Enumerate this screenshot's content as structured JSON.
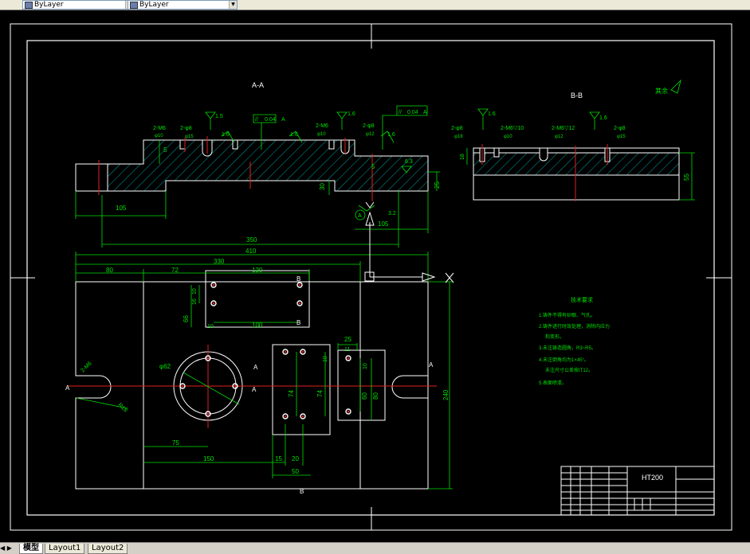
{
  "toolbar": {
    "layer_value": "ByLayer",
    "linetype_value": "ByLayer"
  },
  "drawing": {
    "section_aa": "A-A",
    "section_bb": "B-B",
    "roughness_other": "其余",
    "roughness_63": "6.3",
    "roughness_32": "3.2",
    "roughness_16": "1.6",
    "roughness_15": "1.5",
    "parallel_tol": "0.04",
    "datum_a": "A",
    "dim_105": "105",
    "dim_350": "350",
    "dim_410": "410",
    "dim_330": "330",
    "dim_80": "80",
    "dim_72": "72",
    "dim_120": "120",
    "dim_30": "30",
    "dim_25": "25",
    "dim_5": "5",
    "dim_18": "18",
    "dim_55": "55",
    "dim_66": "66",
    "dim_16": "16",
    "dim_10": "10",
    "dim_100": "100",
    "dim_62": "φ62",
    "dim_75": "75",
    "dim_150": "150",
    "dim_15": "15",
    "dim_20": "20",
    "dim_50": "50",
    "dim_74": "74",
    "dim_11": "11",
    "dim_60": "60",
    "dim_90": "90",
    "dim_80b": "80",
    "dim_240": "240",
    "dim_r18": "R18",
    "hole_m6": "2-M6",
    "hole_m6_10": "2-M6▽10",
    "hole_m6_12": "2-M6▽12",
    "hole_phi8": "2-φ8",
    "hole_phi15": "φ15",
    "hole_phi10": "φ10",
    "hole_phi12": "φ12",
    "hole_phi18": "φ18",
    "label_a": "A",
    "label_b": "B",
    "tech_title": "技术要求",
    "tech_1": "1.铸件不得有砂眼、气孔。",
    "tech_2": "2.铸件进行时效处理，消除内应力",
    "tech_2b": "和变形。",
    "tech_3": "3.未注铸造圆角，R3~R5。",
    "tech_4": "4.未注倒角均为1×45°。",
    "tech_4b": "未注尺寸公差按IT12。",
    "tech_5": "5.表面喷漆。",
    "material": "HT200"
  },
  "tabs": {
    "model": "模型",
    "layout1": "Layout1",
    "layout2": "Layout2"
  }
}
